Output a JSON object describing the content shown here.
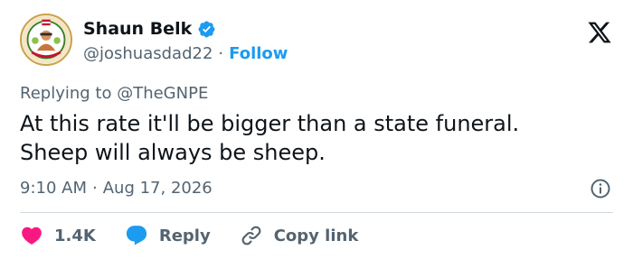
{
  "author": {
    "display_name": "Shaun Belk",
    "handle": "@joshuasdad22",
    "separator": "·",
    "follow_label": "Follow"
  },
  "reply_context": {
    "prefix": "Replying to ",
    "mention": "@TheGNPE"
  },
  "tweet": {
    "lines": [
      "At this rate it'll be bigger than a state funeral.",
      "Sheep will always be sheep."
    ],
    "time": "9:10 AM",
    "separator": "·",
    "date": "Aug 17, 2026"
  },
  "actions": {
    "like_count": "1.4K",
    "reply_label": "Reply",
    "copy_link_label": "Copy link"
  },
  "colors": {
    "accent": "#1d9bf0",
    "like": "#f91880",
    "text": "#0f1419",
    "muted": "#536471",
    "divider": "#cfd9de"
  },
  "icons": [
    "verified-badge-icon",
    "x-logo-icon",
    "info-icon",
    "heart-icon",
    "reply-bubble-icon",
    "link-icon"
  ]
}
